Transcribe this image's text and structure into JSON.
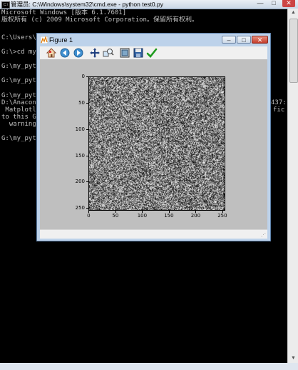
{
  "cmd_window": {
    "title": "管理员: C:\\Windows\\system32\\cmd.exe - python  test0.py",
    "icon_text": "C:\\",
    "controls": {
      "minimize": "—",
      "maximize": "□",
      "close": "✕"
    },
    "lines": [
      "Microsoft Windows [版本 6.1.7601]",
      "版权所有 (c) 2009 Microsoft Corporation。保留所有权利。",
      "",
      "C:\\Users\\A",
      "",
      "G:\\>cd my_",
      "",
      "G:\\my_pyth",
      "",
      "G:\\my_pyth",
      "",
      "G:\\my_pyth",
      "D:\\Anacond",
      " Matplotli",
      "to this GU",
      "  warnings",
      "",
      "G:\\my_pyth"
    ],
    "right_fragments": [
      {
        "line": 12,
        "text": "437:"
      },
      {
        "line": 13,
        "text": "fic"
      }
    ],
    "scrollbar": {
      "up_arrow": "▲",
      "down_arrow": "▼"
    }
  },
  "figure_window": {
    "title": "Figure 1",
    "controls": {
      "minimize": "–",
      "maximize": "□",
      "close": "✕"
    },
    "toolbar": [
      {
        "name": "home-icon",
        "tooltip": "Home"
      },
      {
        "name": "back-icon",
        "tooltip": "Back"
      },
      {
        "name": "forward-icon",
        "tooltip": "Forward"
      },
      {
        "name": "pan-icon",
        "tooltip": "Pan"
      },
      {
        "name": "zoom-icon",
        "tooltip": "Zoom"
      },
      {
        "name": "subplots-icon",
        "tooltip": "Subplots"
      },
      {
        "name": "save-icon",
        "tooltip": "Save"
      },
      {
        "name": "edit-icon",
        "tooltip": "Edit"
      }
    ],
    "status_text": "",
    "grip_glyph": "⋰"
  },
  "plot": {
    "y_ticks": [
      "0",
      "50",
      "100",
      "150",
      "200",
      "250"
    ],
    "x_ticks": [
      "0",
      "50",
      "100",
      "150",
      "200",
      "250"
    ],
    "colors": {
      "background": "#bfbfbf",
      "axes_border": "#000000"
    }
  }
}
